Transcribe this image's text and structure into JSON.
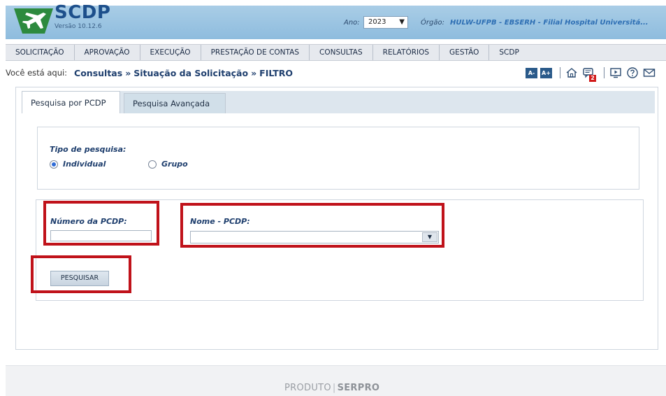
{
  "header": {
    "app_name": "SCDP",
    "version": "Versão 10.12.6",
    "ano_label": "Ano:",
    "ano_value": "2023",
    "orgao_label": "Órgão:",
    "orgao_value": "HULW-UFPB - EBSERH - Filial Hospital Universitá..."
  },
  "menu": {
    "items": [
      {
        "label": "SOLICITAÇÃO"
      },
      {
        "label": "APROVAÇÃO"
      },
      {
        "label": "EXECUÇÃO"
      },
      {
        "label": "PRESTAÇÃO DE CONTAS"
      },
      {
        "label": "CONSULTAS"
      },
      {
        "label": "RELATÓRIOS"
      },
      {
        "label": "GESTÃO"
      },
      {
        "label": "SCDP"
      }
    ]
  },
  "breadcrumb": {
    "prefix": "Você está aqui:",
    "parts": [
      "Consultas",
      "Situação da Solicitação",
      "FILTRO"
    ],
    "separator": "»"
  },
  "tools": {
    "font_decrease": "A-",
    "font_increase": "A+",
    "notification_count": "2",
    "icons": [
      "home-icon",
      "messages-icon",
      "video-icon",
      "help-icon",
      "mail-icon"
    ]
  },
  "tabs": [
    {
      "label": "Pesquisa por PCDP",
      "active": true
    },
    {
      "label": "Pesquisa Avançada",
      "active": false
    }
  ],
  "form": {
    "tipo_label": "Tipo de pesquisa:",
    "options": [
      {
        "label": "Individual",
        "checked": true
      },
      {
        "label": "Grupo",
        "checked": false
      }
    ],
    "numero_label": "Número da PCDP:",
    "numero_value": "",
    "nome_label": "Nome - PCDP:",
    "nome_value": "",
    "search_button": "PESQUISAR"
  },
  "footer": {
    "produto": "PRODUTO",
    "separator": "|",
    "brand": "SERPRO"
  },
  "colors": {
    "header_bg": "#9cc5e2",
    "highlight": "#c0121a",
    "link_blue": "#1f3f6e"
  }
}
